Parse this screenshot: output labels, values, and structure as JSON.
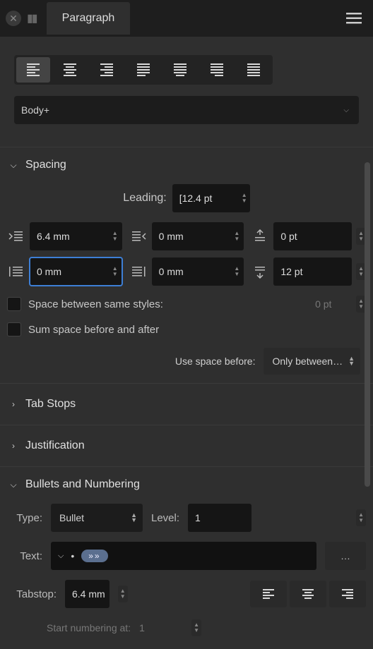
{
  "tab": {
    "title": "Paragraph"
  },
  "style_select": {
    "value": "Body+"
  },
  "sections": {
    "spacing": {
      "title": "Spacing",
      "expanded": true
    },
    "tabstops": {
      "title": "Tab Stops",
      "expanded": false
    },
    "justification": {
      "title": "Justification",
      "expanded": false
    },
    "bullets": {
      "title": "Bullets and Numbering",
      "expanded": true
    }
  },
  "spacing": {
    "leading_label": "Leading:",
    "leading_value": "[12.4 pt",
    "first_indent": "6.4 mm",
    "right_indent": "0 mm",
    "space_before": "0 pt",
    "left_indent": "0 mm",
    "last_indent": "0 mm",
    "space_after": "12 pt",
    "between_label": "Space between same styles:",
    "between_value": "0 pt",
    "sum_label": "Sum space before and after",
    "use_before_label": "Use space before:",
    "use_before_value": "Only between…"
  },
  "bullets": {
    "type_label": "Type:",
    "type_value": "Bullet",
    "level_label": "Level:",
    "level_value": "1",
    "text_label": "Text:",
    "text_bullet": "•",
    "text_pill": "»»",
    "ellipsis": "…",
    "tabstop_label": "Tabstop:",
    "tabstop_value": "6.4 mm",
    "start_label": "Start numbering at:",
    "start_value": "1"
  }
}
